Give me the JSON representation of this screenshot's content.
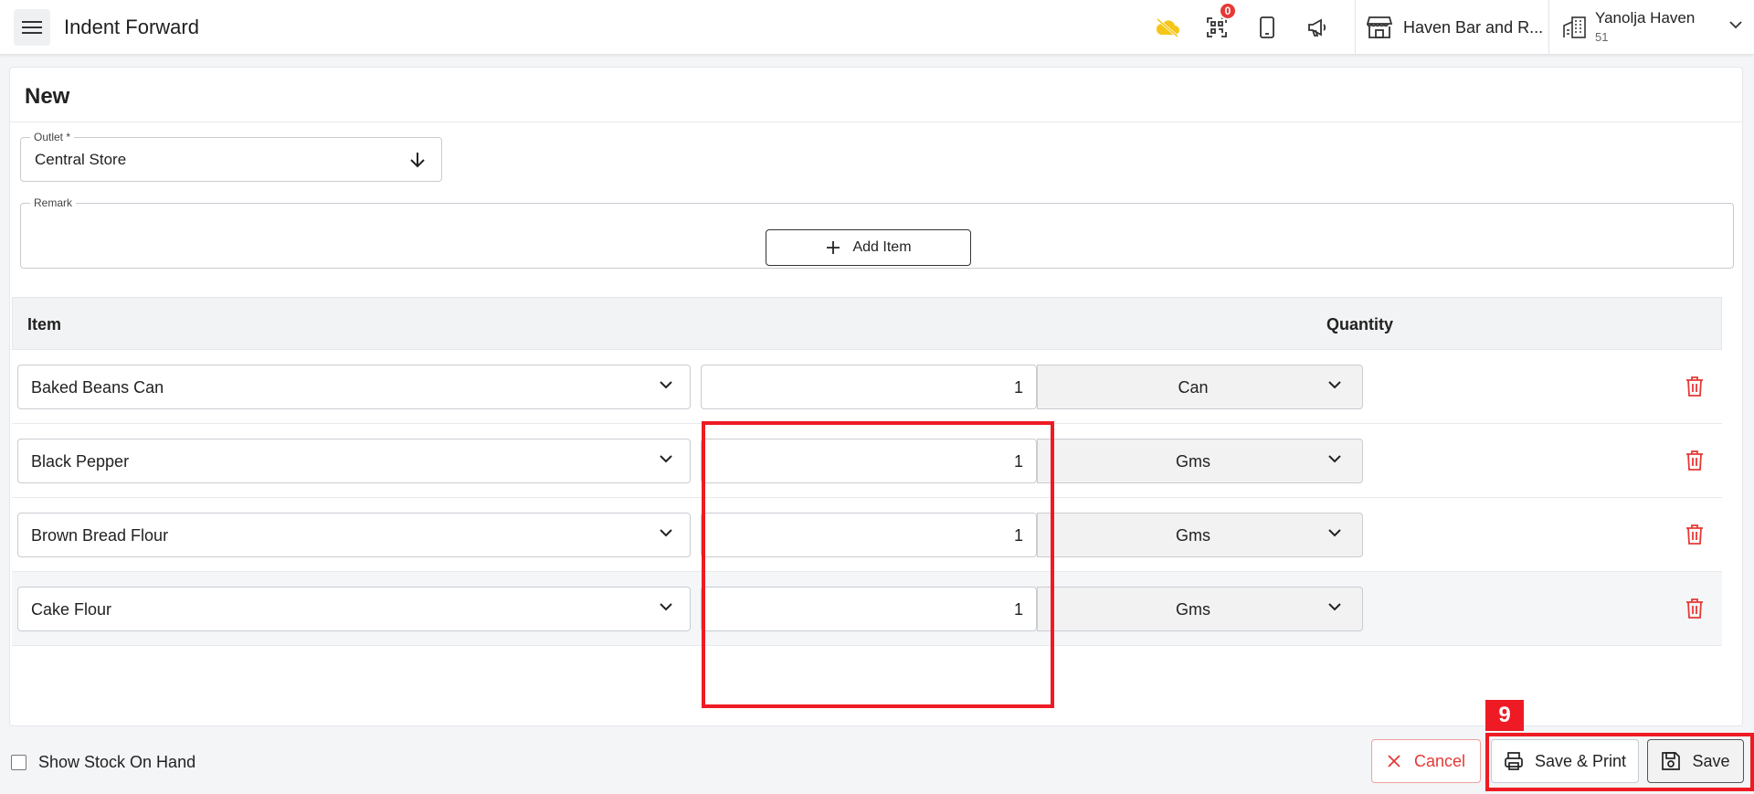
{
  "header": {
    "title": "Indent Forward",
    "notification_count": "0",
    "outlet_name": "Haven Bar and R...",
    "user_name": "Yanolja Haven",
    "user_sub": "51"
  },
  "form": {
    "heading": "New",
    "outlet_label": "Outlet *",
    "outlet_value": "Central Store",
    "remark_label": "Remark",
    "remark_value": "",
    "add_item_label": "Add Item"
  },
  "table": {
    "col_item": "Item",
    "col_quantity": "Quantity",
    "rows": [
      {
        "item": "Baked Beans Can",
        "qty": "1",
        "unit": "Can"
      },
      {
        "item": "Black Pepper",
        "qty": "1",
        "unit": "Gms"
      },
      {
        "item": "Brown Bread Flour",
        "qty": "1",
        "unit": "Gms"
      },
      {
        "item": "Cake Flour",
        "qty": "1",
        "unit": "Gms"
      }
    ]
  },
  "footer": {
    "show_stock_label": "Show Stock On Hand",
    "cancel_label": "Cancel",
    "save_print_label": "Save & Print",
    "save_label": "Save"
  },
  "annotation": {
    "tag": "9"
  },
  "colors": {
    "accent_red": "#ee1b24",
    "danger": "#e53935",
    "cloud_icon": "#f5c518"
  }
}
